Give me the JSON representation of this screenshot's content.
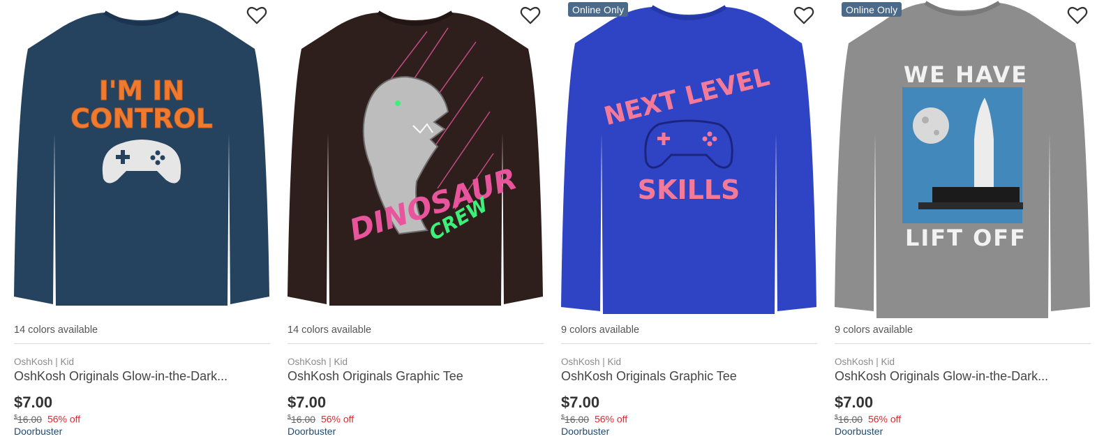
{
  "products": [
    {
      "badge": "",
      "colors": "14 colors available",
      "brand": "OshKosh | Kid",
      "title": "OshKosh Originals Glow-in-the-Dark...",
      "price": "$7.00",
      "old_price_currency": "$",
      "old_price": "16.00",
      "discount": "56% off",
      "promo": "Doorbuster",
      "shirt_color": "#25425f",
      "graphic_lines": [
        "I'M IN",
        "CONTROL"
      ],
      "graphic_color": "#f07b2e"
    },
    {
      "badge": "",
      "colors": "14 colors available",
      "brand": "OshKosh | Kid",
      "title": "OshKosh Originals Graphic Tee",
      "price": "$7.00",
      "old_price_currency": "$",
      "old_price": "16.00",
      "discount": "56% off",
      "promo": "Doorbuster",
      "shirt_color": "#2e1f1d",
      "graphic_lines": [
        "DINOSAUR",
        "CREW"
      ],
      "graphic_color": "#e8559c"
    },
    {
      "badge": "Online Only",
      "colors": "9 colors available",
      "brand": "OshKosh | Kid",
      "title": "OshKosh Originals Graphic Tee",
      "price": "$7.00",
      "old_price_currency": "$",
      "old_price": "16.00",
      "discount": "56% off",
      "promo": "Doorbuster",
      "shirt_color": "#2f44c4",
      "graphic_lines": [
        "NEXT LEVEL",
        "SKILLS"
      ],
      "graphic_color": "#f47a9a"
    },
    {
      "badge": "Online Only",
      "colors": "9 colors available",
      "brand": "OshKosh | Kid",
      "title": "OshKosh Originals Glow-in-the-Dark...",
      "price": "$7.00",
      "old_price_currency": "$",
      "old_price": "16.00",
      "discount": "56% off",
      "promo": "Doorbuster",
      "shirt_color": "#8d8d8d",
      "graphic_lines": [
        "WE HAVE",
        "LIFT OFF"
      ],
      "graphic_color": "#f2f2f2"
    }
  ]
}
